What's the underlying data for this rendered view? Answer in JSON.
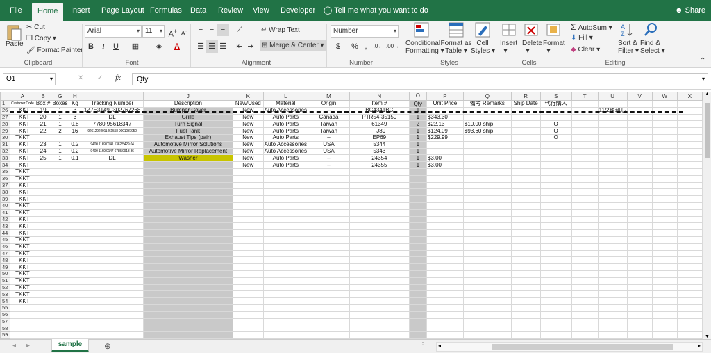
{
  "menu": {
    "tabs": [
      "File",
      "Home",
      "Insert",
      "Page Layout",
      "Formulas",
      "Data",
      "Review",
      "View",
      "Developer"
    ],
    "tell_me": "Tell me what you want to do",
    "share": "Share"
  },
  "ribbon": {
    "clipboard": {
      "paste": "Paste",
      "cut": "Cut",
      "copy": "Copy",
      "format_painter": "Format Painter",
      "label": "Clipboard"
    },
    "font": {
      "name": "Arial",
      "size": "11",
      "bold": "B",
      "italic": "I",
      "underline": "U",
      "label": "Font"
    },
    "alignment": {
      "wrap_text": "Wrap Text",
      "merge_center": "Merge & Center",
      "label": "Alignment"
    },
    "number": {
      "format": "Number",
      "currency": "$",
      "percent": "%",
      "comma": ",",
      "label": "Number"
    },
    "styles": {
      "conditional": "Conditional",
      "conditional2": "Formatting",
      "format_as": "Format as",
      "format_as2": "Table",
      "cell": "Cell",
      "cell2": "Styles",
      "label": "Styles"
    },
    "cells": {
      "insert": "Insert",
      "delete": "Delete",
      "format": "Format",
      "label": "Cells"
    },
    "editing": {
      "autosum": "AutoSum",
      "fill": "Fill",
      "clear": "Clear",
      "sort": "Sort &",
      "sort2": "Filter",
      "find": "Find &",
      "find2": "Select",
      "label": "Editing"
    }
  },
  "formula_bar": {
    "name_box": "O1",
    "cancel": "✕",
    "enter": "✓",
    "fx": "fx",
    "content": "Qty"
  },
  "columns": [
    "A",
    "B",
    "G",
    "H",
    "I",
    "J",
    "K",
    "L",
    "M",
    "N",
    "O",
    "P",
    "Q",
    "R",
    "S",
    "T",
    "U",
    "V",
    "W",
    "X"
  ],
  "header_row": [
    "Customer Code",
    "Box #",
    "Boxes",
    "Kg",
    "Tracking Number",
    "Description",
    "New/Used",
    "Material",
    "Origin",
    "Item #",
    "Qty",
    "Unit Price",
    "備考 Remarks",
    "Ship Date",
    "代行購入",
    "",
    "",
    "",
    "",
    ""
  ],
  "rows": [
    {
      "n": "26",
      "cells": [
        "TKKT",
        "19",
        "1",
        "3",
        "1Z7E31490302767268",
        "Bumper Cover",
        "New",
        "Auto Accessories",
        "–",
        "BC4341BC",
        "1",
        "",
        "",
        "",
        "",
        "",
        "11/2補却し",
        "",
        "",
        ""
      ]
    },
    {
      "n": "27",
      "cells": [
        "TKKT",
        "20",
        "1",
        "3",
        "DL",
        "Grille",
        "New",
        "Auto Parts",
        "Canada",
        "PTR54-35150",
        "1",
        "$343.30",
        "",
        "",
        "",
        "",
        "",
        "",
        "",
        ""
      ]
    },
    {
      "n": "28",
      "cells": [
        "TKKT",
        "21",
        "1",
        "0.8",
        "7780 95618347",
        "Turn Signal",
        "New",
        "Auto Parts",
        "Taiwan",
        "61349",
        "2",
        "$22.13",
        "$10.00 ship",
        "",
        "O",
        "",
        "",
        "",
        "",
        ""
      ]
    },
    {
      "n": "29",
      "cells": [
        "TKKT",
        "22",
        "2",
        "16",
        "92612924911461558 9001037950",
        "Fuel Tank",
        "New",
        "Auto Parts",
        "Taiwan",
        "FJ89",
        "1",
        "$124.09",
        "$93.60 ship",
        "",
        "O",
        "",
        "",
        "",
        "",
        ""
      ]
    },
    {
      "n": "30",
      "cells": [
        "TKKT",
        "",
        "",
        "",
        "",
        "Exhaust Tips (pair)",
        "New",
        "Auto Parts",
        "–",
        "EP69",
        "1",
        "$229.99",
        "",
        "",
        "O",
        "",
        "",
        "",
        "",
        ""
      ]
    },
    {
      "n": "31",
      "cells": [
        "TKKT",
        "23",
        "1",
        "0.2",
        "9400 1169 0141 1362 5429 04",
        "Automotive Mirror Solutions",
        "New",
        "Auto Accessories",
        "USA",
        "5344",
        "1",
        "",
        "",
        "",
        "",
        "",
        "",
        "",
        "",
        ""
      ]
    },
    {
      "n": "32",
      "cells": [
        "TKKT",
        "24",
        "1",
        "0.2",
        "9400 1169 0147 6785 9913 36",
        "Automotive Mirror Replacement",
        "New",
        "Auto Accessories",
        "USA",
        "5343",
        "1",
        "",
        "",
        "",
        "",
        "",
        "",
        "",
        "",
        ""
      ]
    },
    {
      "n": "33",
      "cells": [
        "TKKT",
        "25",
        "1",
        "0.1",
        "DL",
        "Washer",
        "New",
        "Auto Parts",
        "–",
        "24354",
        "1",
        "$3.00",
        "",
        "",
        "",
        "",
        "",
        "",
        "",
        ""
      ]
    },
    {
      "n": "34",
      "cells": [
        "TKKT",
        "",
        "",
        "",
        "",
        "",
        "New",
        "Auto Parts",
        "–",
        "24355",
        "1",
        "$3.00",
        "",
        "",
        "",
        "",
        "",
        "",
        "",
        ""
      ]
    }
  ],
  "empty_rows": [
    {
      "n": "35",
      "a": "TKKT"
    },
    {
      "n": "36",
      "a": "TKKT"
    },
    {
      "n": "37",
      "a": "TKKT"
    },
    {
      "n": "38",
      "a": "TKKT"
    },
    {
      "n": "39",
      "a": "TKKT"
    },
    {
      "n": "40",
      "a": "TKKT"
    },
    {
      "n": "41",
      "a": "TKKT"
    },
    {
      "n": "42",
      "a": "TKKT"
    },
    {
      "n": "43",
      "a": "TKKT"
    },
    {
      "n": "44",
      "a": "TKKT"
    },
    {
      "n": "45",
      "a": "TKKT"
    },
    {
      "n": "46",
      "a": "TKKT"
    },
    {
      "n": "47",
      "a": "TKKT"
    },
    {
      "n": "48",
      "a": "TKKT"
    },
    {
      "n": "49",
      "a": "TKKT"
    },
    {
      "n": "50",
      "a": "TKKT"
    },
    {
      "n": "51",
      "a": "TKKT"
    },
    {
      "n": "52",
      "a": "TKKT"
    },
    {
      "n": "53",
      "a": "TKKT"
    },
    {
      "n": "54",
      "a": "TKKT"
    },
    {
      "n": "55",
      "a": ""
    },
    {
      "n": "56",
      "a": ""
    },
    {
      "n": "57",
      "a": ""
    },
    {
      "n": "58",
      "a": ""
    },
    {
      "n": "59",
      "a": ""
    }
  ],
  "sheet_tab": "sample",
  "colors": {
    "brand": "#217346",
    "gray_column": "#c9c9c9",
    "washer_fill": "#c8c400"
  }
}
